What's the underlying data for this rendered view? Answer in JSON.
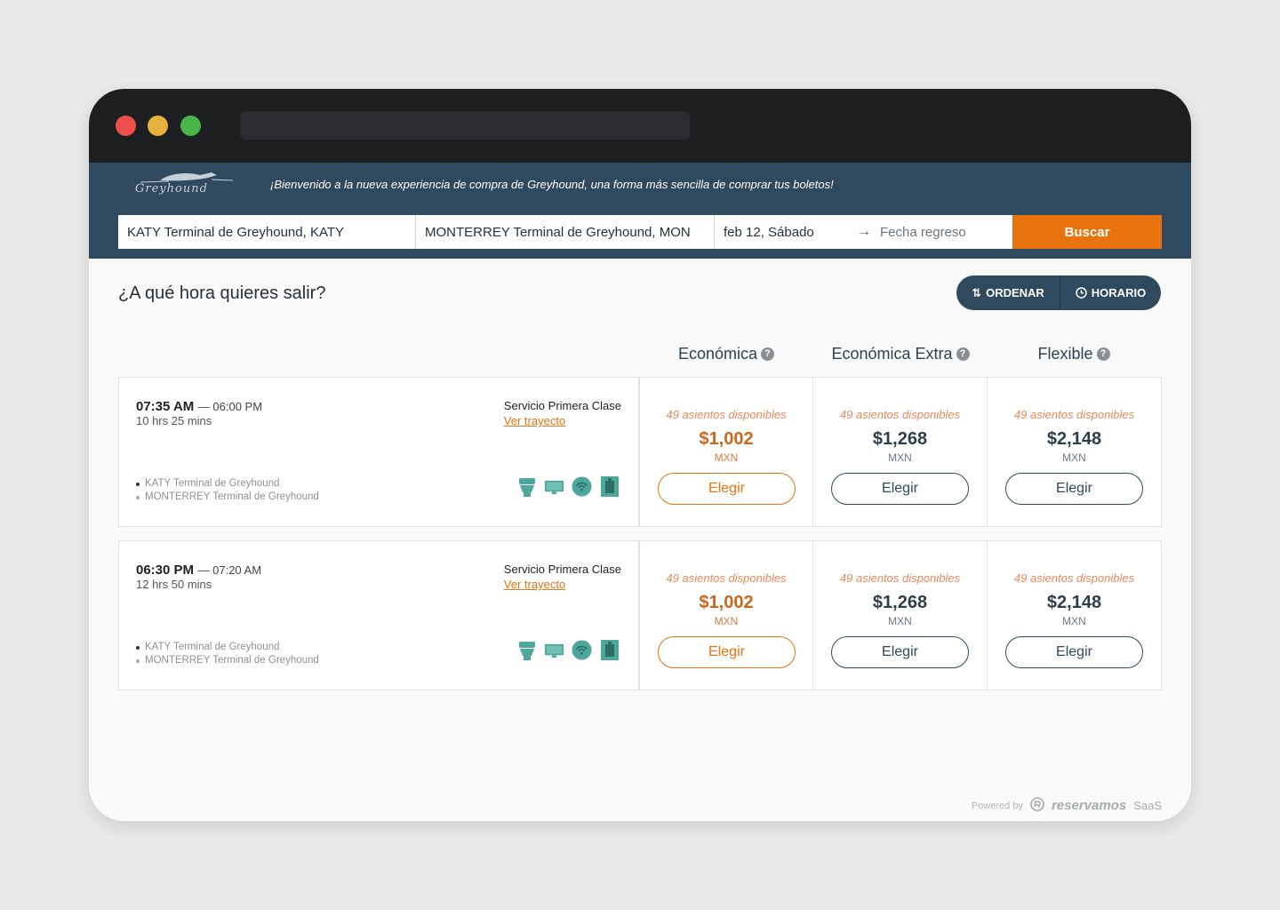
{
  "header": {
    "logo_text": "Greyhound",
    "welcome": "¡Bienvenido a la nueva experiencia de compra de Greyhound, una forma más sencilla de comprar tus boletos!"
  },
  "search": {
    "origin": "KATY Terminal de Greyhound, KATY",
    "destination": "MONTERREY Terminal de Greyhound, MON",
    "date": "feb 12, Sábado",
    "return_placeholder": "Fecha regreso",
    "button": "Buscar"
  },
  "main": {
    "question": "¿A qué hora quieres salir?",
    "sort_label": "ORDENAR",
    "schedule_label": "HORARIO",
    "columns": [
      "Económica",
      "Económica Extra",
      "Flexible"
    ],
    "help_glyph": "?"
  },
  "trips": [
    {
      "departure": "07:35 AM",
      "arrival": "06:00 PM",
      "duration": "10 hrs 25 mins",
      "service": "Servicio Primera Clase",
      "route_link": "Ver trayecto",
      "origin": "KATY Terminal de Greyhound",
      "destination": "MONTERREY Terminal de Greyhound",
      "fares": [
        {
          "seats": "49 asientos disponibles",
          "price": "$1,002",
          "currency": "MXN",
          "button": "Elegir"
        },
        {
          "seats": "49 asientos disponibles",
          "price": "$1,268",
          "currency": "MXN",
          "button": "Elegir"
        },
        {
          "seats": "49 asientos disponibles",
          "price": "$2,148",
          "currency": "MXN",
          "button": "Elegir"
        }
      ]
    },
    {
      "departure": "06:30 PM",
      "arrival": "07:20 AM",
      "duration": "12 hrs 50 mins",
      "service": "Servicio Primera Clase",
      "route_link": "Ver trayecto",
      "origin": "KATY Terminal de Greyhound",
      "destination": "MONTERREY Terminal de Greyhound",
      "fares": [
        {
          "seats": "49 asientos disponibles",
          "price": "$1,002",
          "currency": "MXN",
          "button": "Elegir"
        },
        {
          "seats": "49 asientos disponibles",
          "price": "$1,268",
          "currency": "MXN",
          "button": "Elegir"
        },
        {
          "seats": "49 asientos disponibles",
          "price": "$2,148",
          "currency": "MXN",
          "button": "Elegir"
        }
      ]
    }
  ],
  "footer": {
    "powered_by": "Powered by",
    "brand": "reservamos",
    "suffix": "SaaS"
  },
  "colors": {
    "header_bg": "#2f4a5e",
    "accent": "#e8730e",
    "amenity": "#4ea79a"
  },
  "icons": [
    "toilet-icon",
    "screen-icon",
    "wifi-icon",
    "outlet-icon"
  ]
}
